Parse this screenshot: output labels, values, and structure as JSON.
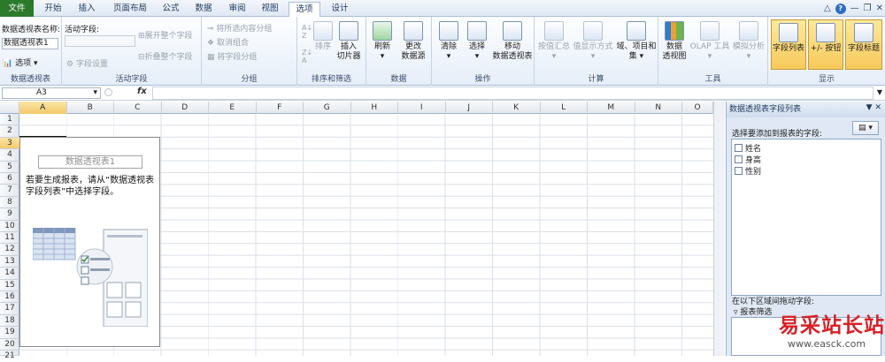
{
  "tabs": [
    "文件",
    "开始",
    "插入",
    "页面布局",
    "公式",
    "数据",
    "审阅",
    "视图",
    "选项",
    "设计"
  ],
  "groups": {
    "pivottable": {
      "label": "数据透视表",
      "name_label": "数据透视表名称:",
      "name_value": "数据透视表1",
      "options": "选项"
    },
    "activefield": {
      "label": "活动字段",
      "title": "活动字段:",
      "field_settings": "字段设置",
      "expand": "展开整个字段",
      "collapse": "折叠整个字段"
    },
    "group": {
      "label": "分组",
      "sel": "将所选内容分组",
      "ungroup": "取消组合",
      "field": "将字段分组"
    },
    "sort": {
      "label": "排序和筛选",
      "sort": "排序",
      "slicer": "插入\n切片器"
    },
    "data": {
      "label": "数据",
      "refresh": "刷新",
      "change": "更改\n数据源"
    },
    "actions": {
      "label": "操作",
      "clear": "清除",
      "select": "选择",
      "move": "移动\n数据透视表"
    },
    "calc": {
      "label": "计算",
      "summ": "按值汇总",
      "show": "值显示方式",
      "fields": "域、项目和\n集"
    },
    "tools": {
      "label": "工具",
      "chart": "数据\n透视图",
      "olap": "OLAP 工具",
      "whatif": "模拟分析"
    },
    "show": {
      "label": "显示",
      "list": "字段列表",
      "buttons": "+/- 按钮",
      "headers": "字段标题"
    }
  },
  "namebox": "A3",
  "fx": "fx",
  "columns": [
    "A",
    "B",
    "C",
    "D",
    "E",
    "F",
    "G",
    "H",
    "I",
    "J",
    "K",
    "L",
    "M",
    "N",
    "O"
  ],
  "rows": [
    "1",
    "2",
    "3",
    "4",
    "5",
    "6",
    "7",
    "8",
    "9",
    "10",
    "11",
    "12",
    "13",
    "14",
    "15",
    "16",
    "17",
    "18",
    "19",
    "20",
    "21"
  ],
  "pivot": {
    "title": "数据透视表1",
    "message": "若要生成报表，请从“数据透视表字段列表”中选择字段。"
  },
  "panel": {
    "title": "数据透视表字段列表",
    "choose": "选择要添加到报表的字段:",
    "fields": [
      "姓名",
      "身高",
      "性别"
    ],
    "drag": "在以下区域间拖动字段:",
    "filter": "报表筛选"
  },
  "watermark": {
    "text": "易采站长站",
    "url": "www.easck.com"
  }
}
